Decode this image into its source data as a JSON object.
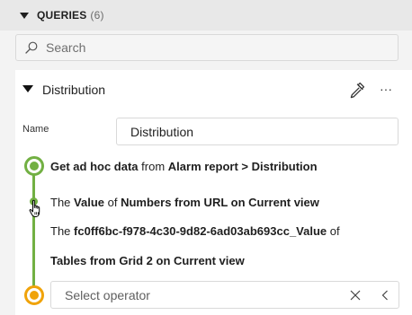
{
  "queries": {
    "title": "QUERIES",
    "count": "(6)"
  },
  "search": {
    "placeholder": "Search",
    "value": ""
  },
  "query": {
    "title": "Distribution",
    "more_label": "···",
    "name_label": "Name",
    "name_value": "Distribution",
    "steps": {
      "line1": {
        "action": "Get ad hoc data",
        "from": "from",
        "source": "Alarm report > Distribution"
      },
      "line2": {
        "the": "The",
        "value": "Value",
        "of": "of",
        "target": "Numbers from URL on Current view"
      },
      "line3": {
        "the": "The",
        "id": "fc0ff6bc-f978-4c30-9d82-6ad03ab693cc_Value",
        "of": "of"
      },
      "line4": {
        "target": "Tables from Grid 2 on Current view"
      }
    },
    "operator": {
      "placeholder": "Select operator"
    }
  },
  "colors": {
    "flow_green": "#72b043",
    "end_orange": "#f0a30a",
    "header_bg": "#e8e8e8"
  },
  "icons": [
    "caret-down-icon",
    "search-icon",
    "pick-icon",
    "more-icon",
    "clear-icon",
    "chevron-left-icon",
    "hand-cursor-icon"
  ]
}
